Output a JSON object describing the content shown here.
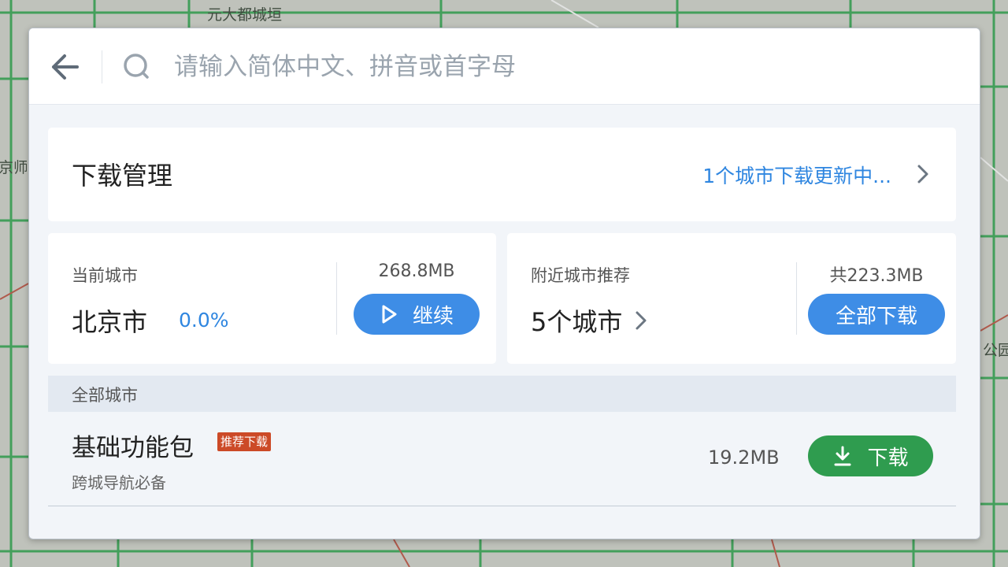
{
  "map": {
    "labels": [
      "元大都城垣",
      "京师",
      "公园"
    ]
  },
  "search": {
    "placeholder": "请输入简体中文、拼音或首字母",
    "value": ""
  },
  "download_manager": {
    "title": "下载管理",
    "status": "1个城市下载更新中..."
  },
  "current_city": {
    "label": "当前城市",
    "name": "北京市",
    "progress_text": "0.0%",
    "size": "268.8MB",
    "button_label": "继续"
  },
  "nearby": {
    "label": "附近城市推荐",
    "count_text": "5个城市",
    "size": "共223.3MB",
    "button_label": "全部下载"
  },
  "all_cities": {
    "header": "全部城市",
    "packages": [
      {
        "title": "基础功能包",
        "badge": "推荐下载",
        "subtitle": "跨城导航必备",
        "size": "19.2MB",
        "button_label": "下载"
      }
    ]
  },
  "colors": {
    "accent_blue": "#3e8de6",
    "link_blue": "#2f86e0",
    "download_green": "#2f9c4f",
    "badge_red": "#cc4a27"
  }
}
